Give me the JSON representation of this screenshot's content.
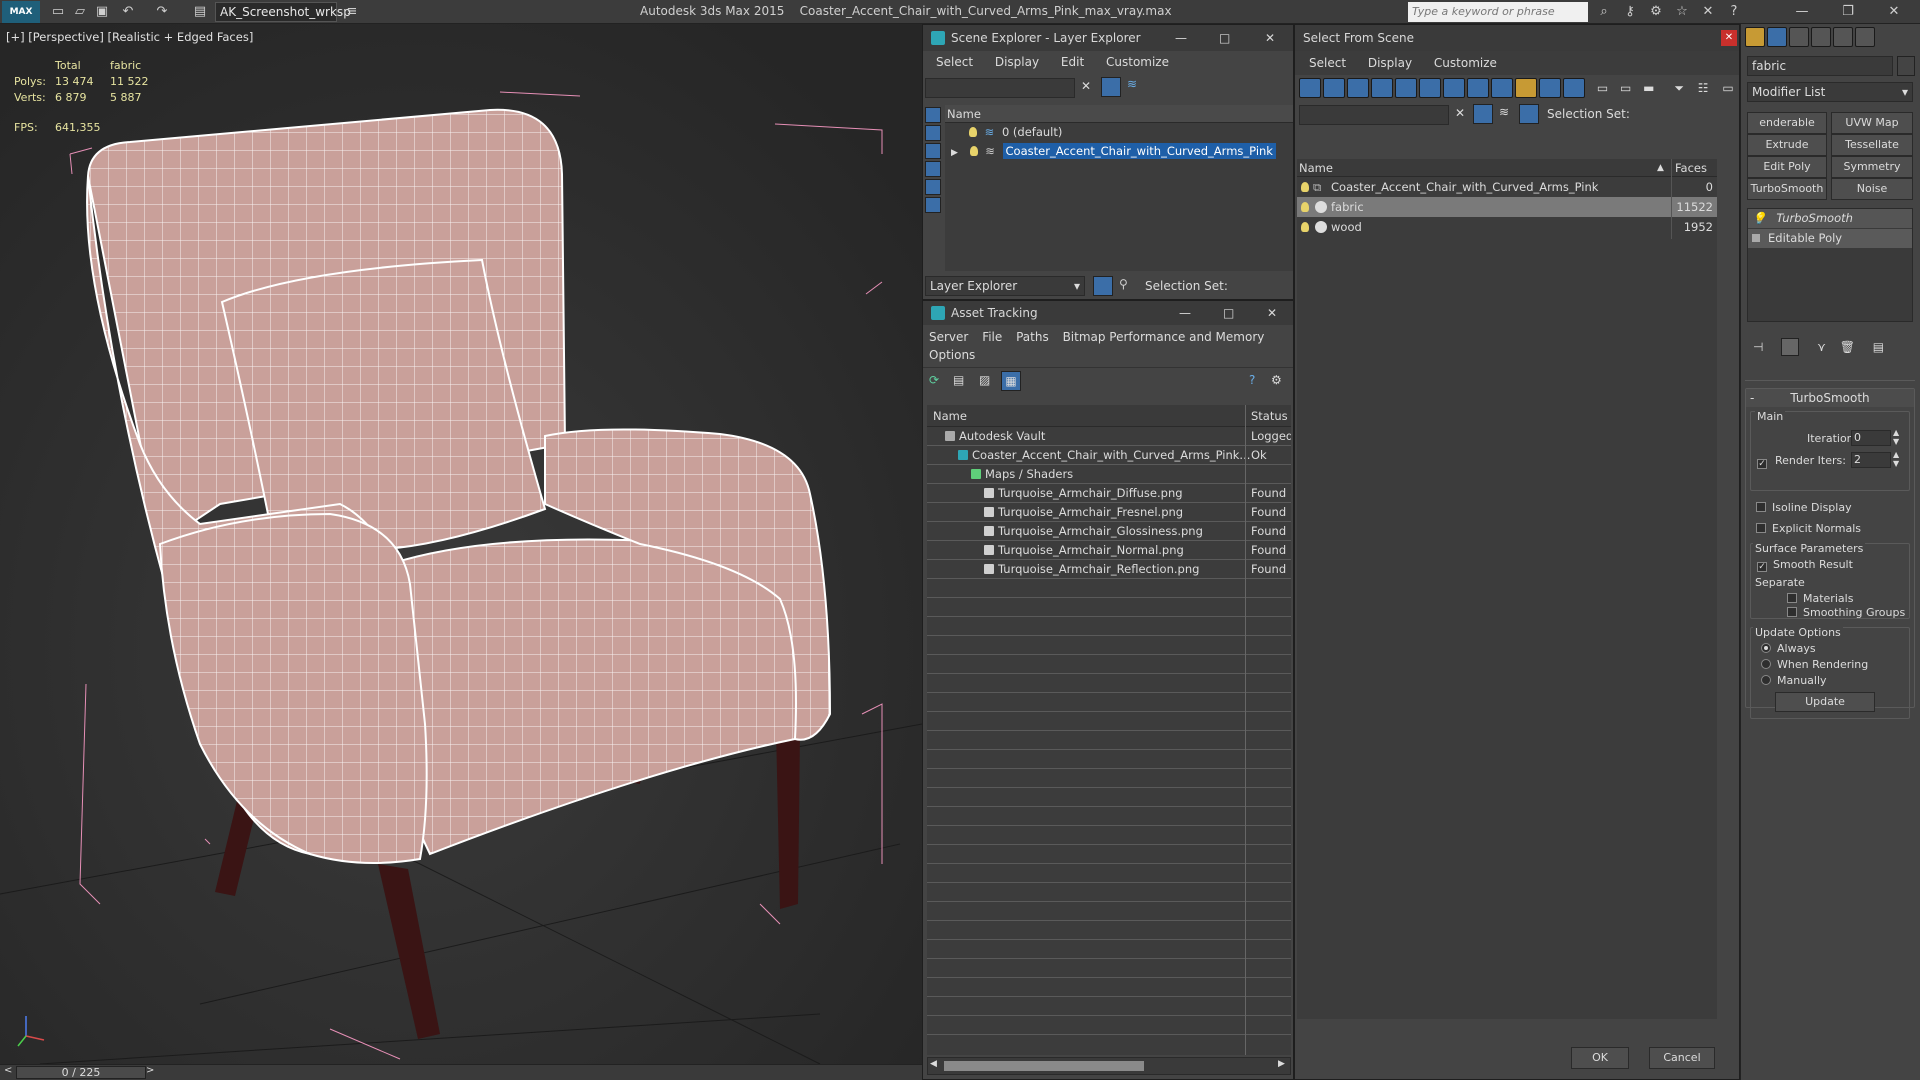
{
  "titlebar": {
    "workspace": "AK_Screenshot_wrksp",
    "app_name": "Autodesk 3ds Max  2015",
    "file_name": "Coaster_Accent_Chair_with_Curved_Arms_Pink_max_vray.max",
    "search_placeholder": "Type a keyword or phrase"
  },
  "viewport": {
    "label": "[+] [Perspective] [Realistic + Edged Faces]",
    "stats": {
      "col_total": "Total",
      "col_sel": "fabric",
      "polys_label": "Polys:",
      "polys_total": "13 474",
      "polys_sel": "11 522",
      "verts_label": "Verts:",
      "verts_total": "6 879",
      "verts_sel": "5 887",
      "fps_label": "FPS:",
      "fps_value": "641,355"
    },
    "timeline": "0 / 225",
    "fabric_color": "#c9a09a",
    "wood_color": "#3a1414"
  },
  "scene_explorer": {
    "title": "Scene Explorer - Layer Explorer",
    "menu": [
      "Select",
      "Display",
      "Edit",
      "Customize"
    ],
    "col_name": "Name",
    "rows": [
      "0 (default)",
      "Coaster_Accent_Chair_with_Curved_Arms_Pink"
    ],
    "footer_dd": "Layer Explorer",
    "footer_sel": "Selection Set:"
  },
  "asset_tracking": {
    "title": "Asset Tracking",
    "menu": [
      "Server",
      "File",
      "Paths",
      "Bitmap Performance and Memory"
    ],
    "menu2": "Options",
    "col_name": "Name",
    "col_status": "Status",
    "rows": [
      {
        "name": "Autodesk Vault",
        "status": "Logged",
        "indent": 0
      },
      {
        "name": "Coaster_Accent_Chair_with_Curved_Arms_Pink...",
        "status": "Ok",
        "indent": 1
      },
      {
        "name": "Maps / Shaders",
        "status": "",
        "indent": 2
      },
      {
        "name": "Turquoise_Armchair_Diffuse.png",
        "status": "Found",
        "indent": 3
      },
      {
        "name": "Turquoise_Armchair_Fresnel.png",
        "status": "Found",
        "indent": 3
      },
      {
        "name": "Turquoise_Armchair_Glossiness.png",
        "status": "Found",
        "indent": 3
      },
      {
        "name": "Turquoise_Armchair_Normal.png",
        "status": "Found",
        "indent": 3
      },
      {
        "name": "Turquoise_Armchair_Reflection.png",
        "status": "Found",
        "indent": 3
      }
    ]
  },
  "select_from_scene": {
    "title": "Select From Scene",
    "menu": [
      "Select",
      "Display",
      "Customize"
    ],
    "sel_set": "Selection Set:",
    "col_name": "Name",
    "col_faces": "Faces",
    "rows": [
      {
        "name": "Coaster_Accent_Chair_with_Curved_Arms_Pink",
        "faces": "0"
      },
      {
        "name": "fabric",
        "faces": "11522"
      },
      {
        "name": "wood",
        "faces": "1952"
      }
    ],
    "ok": "OK",
    "cancel": "Cancel"
  },
  "command_panel": {
    "object_name": "fabric",
    "modifier_list": "Modifier List",
    "buttons": [
      "enderable Splir",
      "UVW Map",
      "Extrude",
      "Tessellate",
      "Edit Poly",
      "Symmetry",
      "TurboSmooth",
      "Noise"
    ],
    "stack": [
      "TurboSmooth",
      "Editable Poly"
    ],
    "rollout_title": "TurboSmooth",
    "main": "Main",
    "iterations_label": "Iterations:",
    "iterations": "0",
    "render_iters_label": "Render Iters:",
    "render_iters": "2",
    "isoline": "Isoline Display",
    "explicit_normals": "Explicit Normals",
    "surface_params": "Surface Parameters",
    "smooth_result": "Smooth Result",
    "separate": "Separate",
    "materials": "Materials",
    "smoothing_groups": "Smoothing Groups",
    "update_options": "Update Options",
    "always": "Always",
    "when_rendering": "When Rendering",
    "manually": "Manually",
    "update": "Update"
  }
}
